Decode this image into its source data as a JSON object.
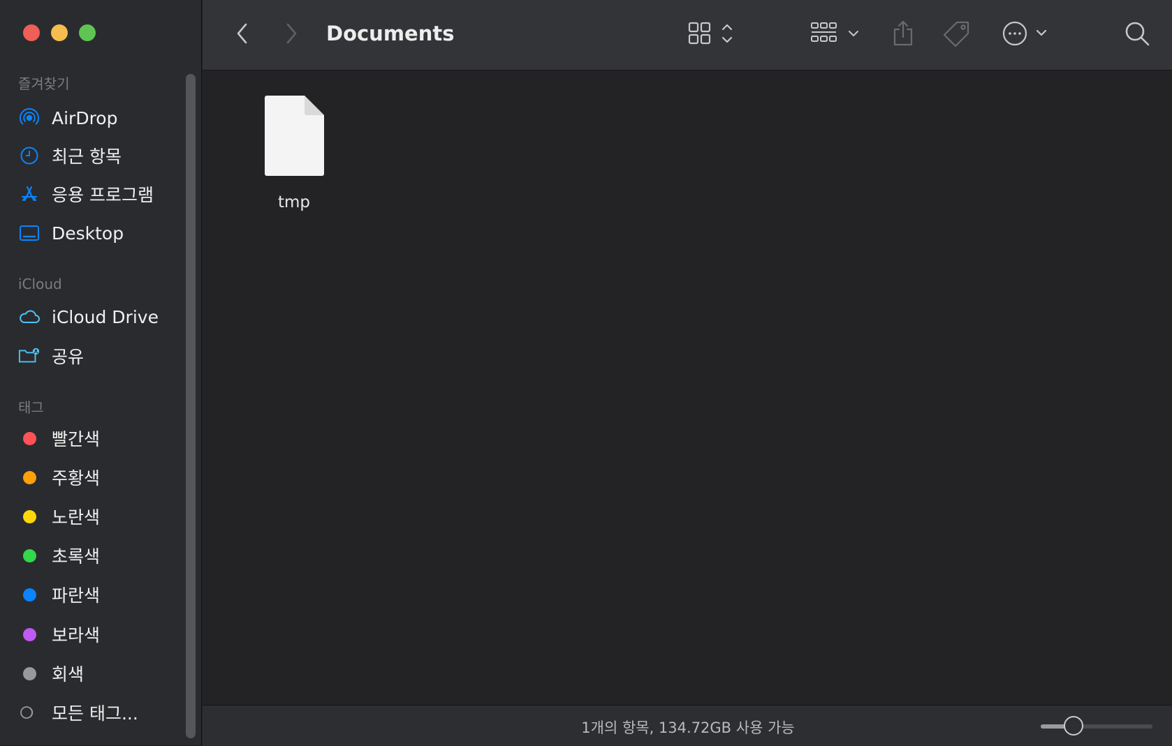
{
  "window": {
    "title": "Documents"
  },
  "sidebar": {
    "sections": [
      {
        "label": "즐겨찾기"
      },
      {
        "label": "iCloud"
      },
      {
        "label": "태그"
      }
    ],
    "favorites": [
      {
        "label": "AirDrop",
        "icon": "airdrop-icon"
      },
      {
        "label": "최근 항목",
        "icon": "clock-icon"
      },
      {
        "label": "응용 프로그램",
        "icon": "applications-icon"
      },
      {
        "label": "Desktop",
        "icon": "desktop-icon"
      }
    ],
    "icloud": [
      {
        "label": "iCloud Drive",
        "icon": "cloud-icon"
      },
      {
        "label": "공유",
        "icon": "shared-folder-icon"
      }
    ],
    "tags": [
      {
        "label": "빨간색",
        "color": "#ff5257"
      },
      {
        "label": "주황색",
        "color": "#ff9f0a"
      },
      {
        "label": "노란색",
        "color": "#ffd60a"
      },
      {
        "label": "초록색",
        "color": "#32d74b"
      },
      {
        "label": "파란색",
        "color": "#0a84ff"
      },
      {
        "label": "보라색",
        "color": "#bf5af2"
      },
      {
        "label": "회색",
        "color": "#98989d"
      },
      {
        "label": "모든 태그...",
        "color": ""
      }
    ]
  },
  "toolbar": {
    "back": "back-chevron-icon",
    "forward": "forward-chevron-icon",
    "view_mode": "grid-view-icon",
    "group": "group-icon",
    "share": "share-icon",
    "tag": "tag-icon",
    "more": "more-icon",
    "search": "search-icon"
  },
  "content": {
    "files": [
      {
        "name": "tmp",
        "icon": "document-icon"
      }
    ]
  },
  "statusbar": {
    "text": "1개의 항목, 134.72GB 사용 가능",
    "icon_size": 0.25
  },
  "colors": {
    "accent": "#0a84ff",
    "icloud_icon": "#4fc3f7"
  }
}
